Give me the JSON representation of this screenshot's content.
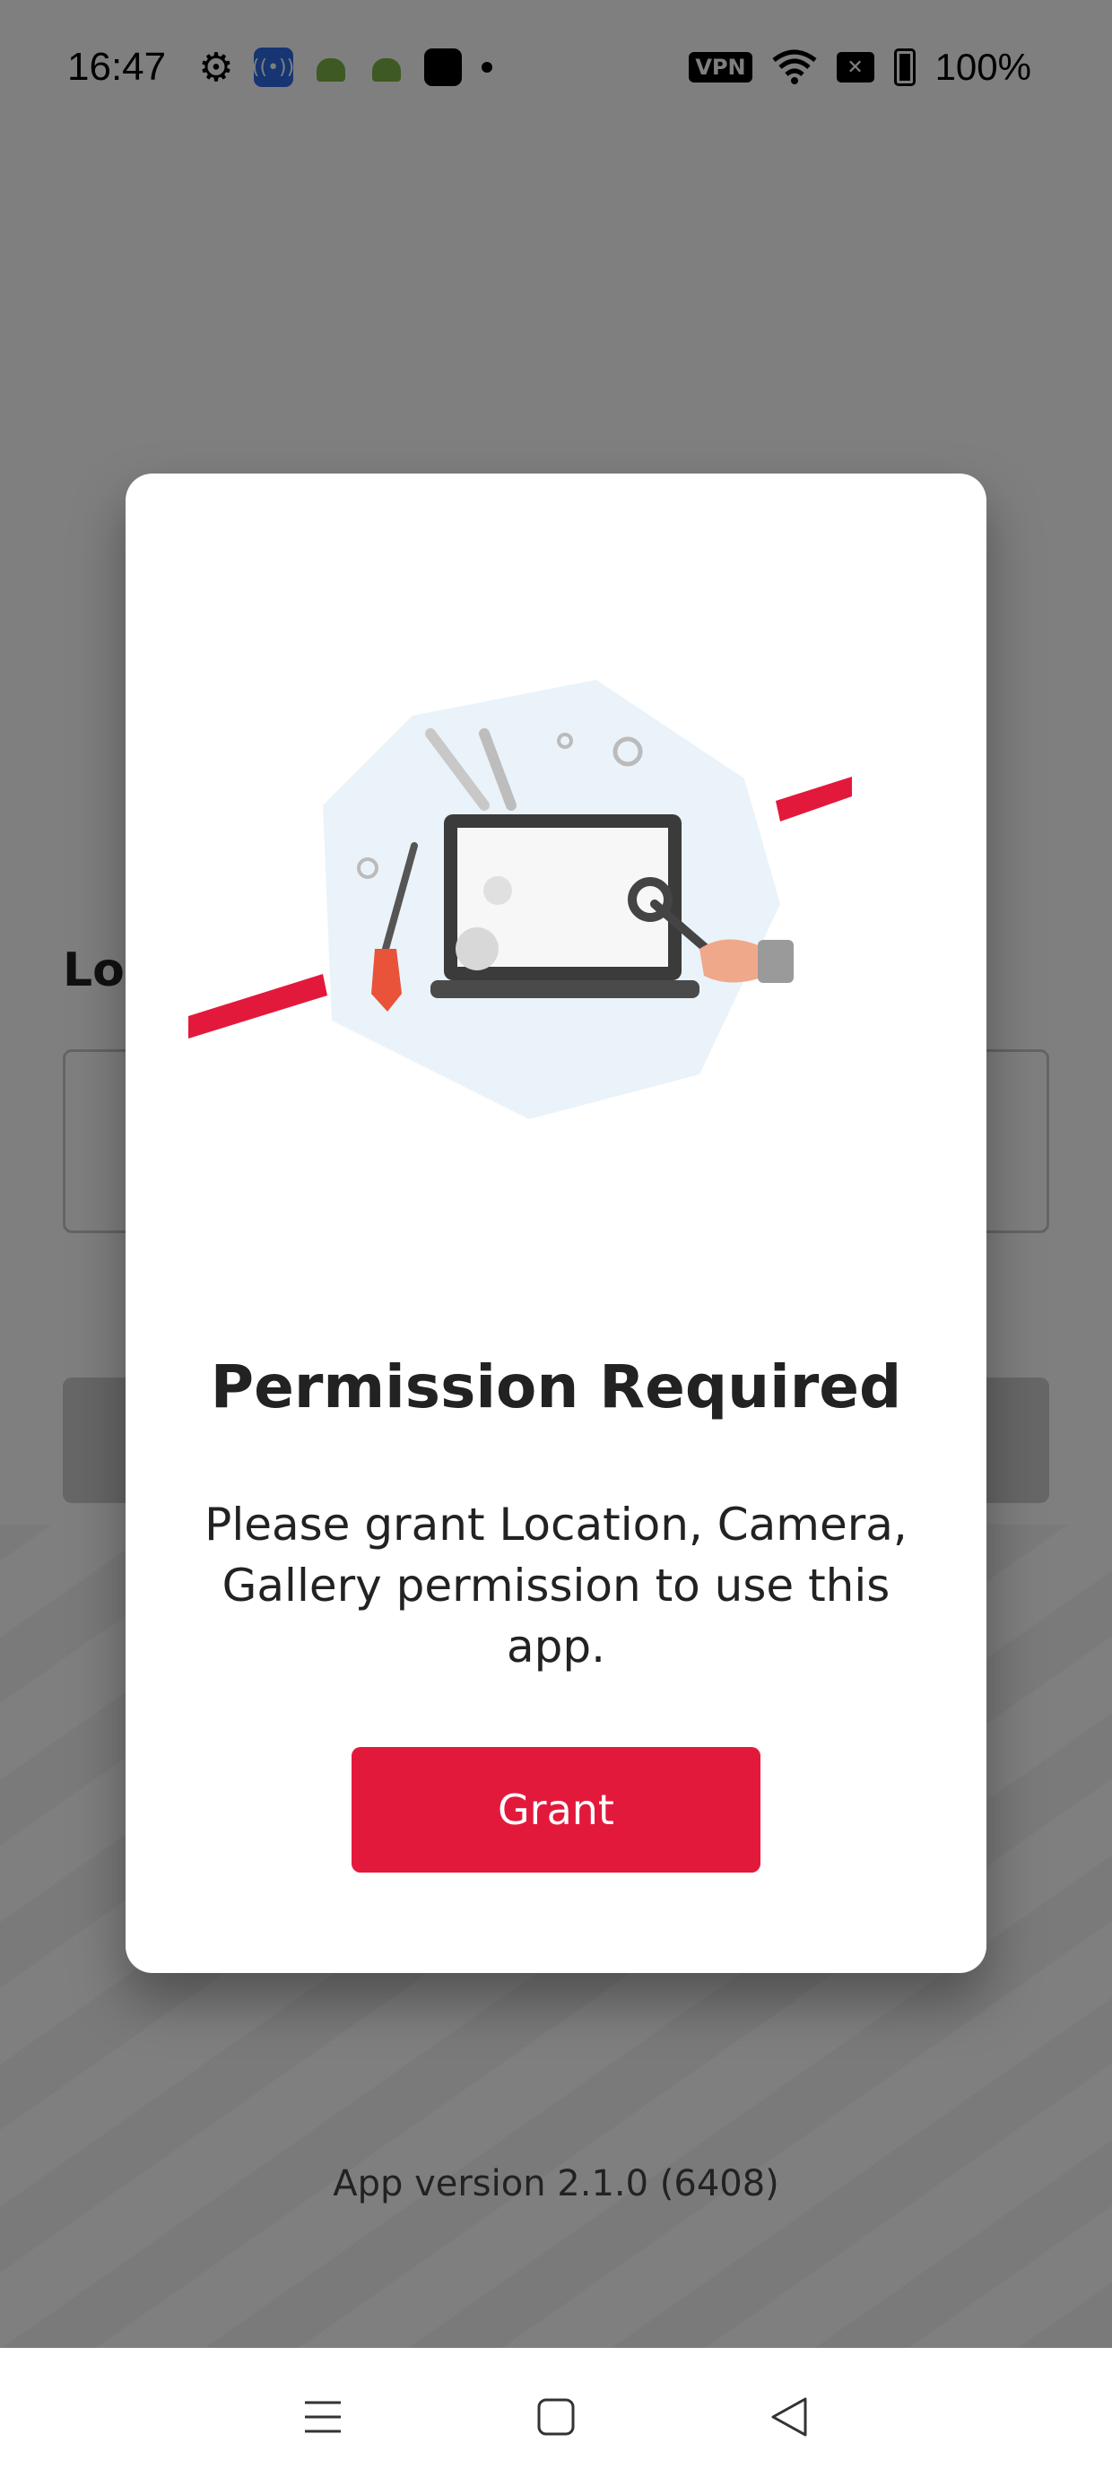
{
  "status_bar": {
    "time": "16:47",
    "vpn_label": "VPN",
    "battery_percent": "100%",
    "icons": [
      "gear-icon",
      "broadcast-icon",
      "android-icon",
      "android-icon",
      "app-icon",
      "dot-icon",
      "vpn-icon",
      "wifi-icon",
      "no-signal-icon",
      "battery-icon"
    ]
  },
  "background": {
    "login_title": "Log",
    "app_version": "App version 2.1.0 (6408)"
  },
  "dialog": {
    "illustration": "tools-laptop-illustration",
    "title": "Permission Required",
    "message": "Please grant Location, Camera, Gallery permission to use this app.",
    "grant_label": "Grant"
  },
  "nav_bar": {
    "icons": [
      "menu-icon",
      "home-icon",
      "back-icon"
    ]
  },
  "colors": {
    "accent": "#e3193c",
    "overlay": "rgba(0,0,0,0.5)",
    "illustration_bg": "#eaf3f9"
  }
}
